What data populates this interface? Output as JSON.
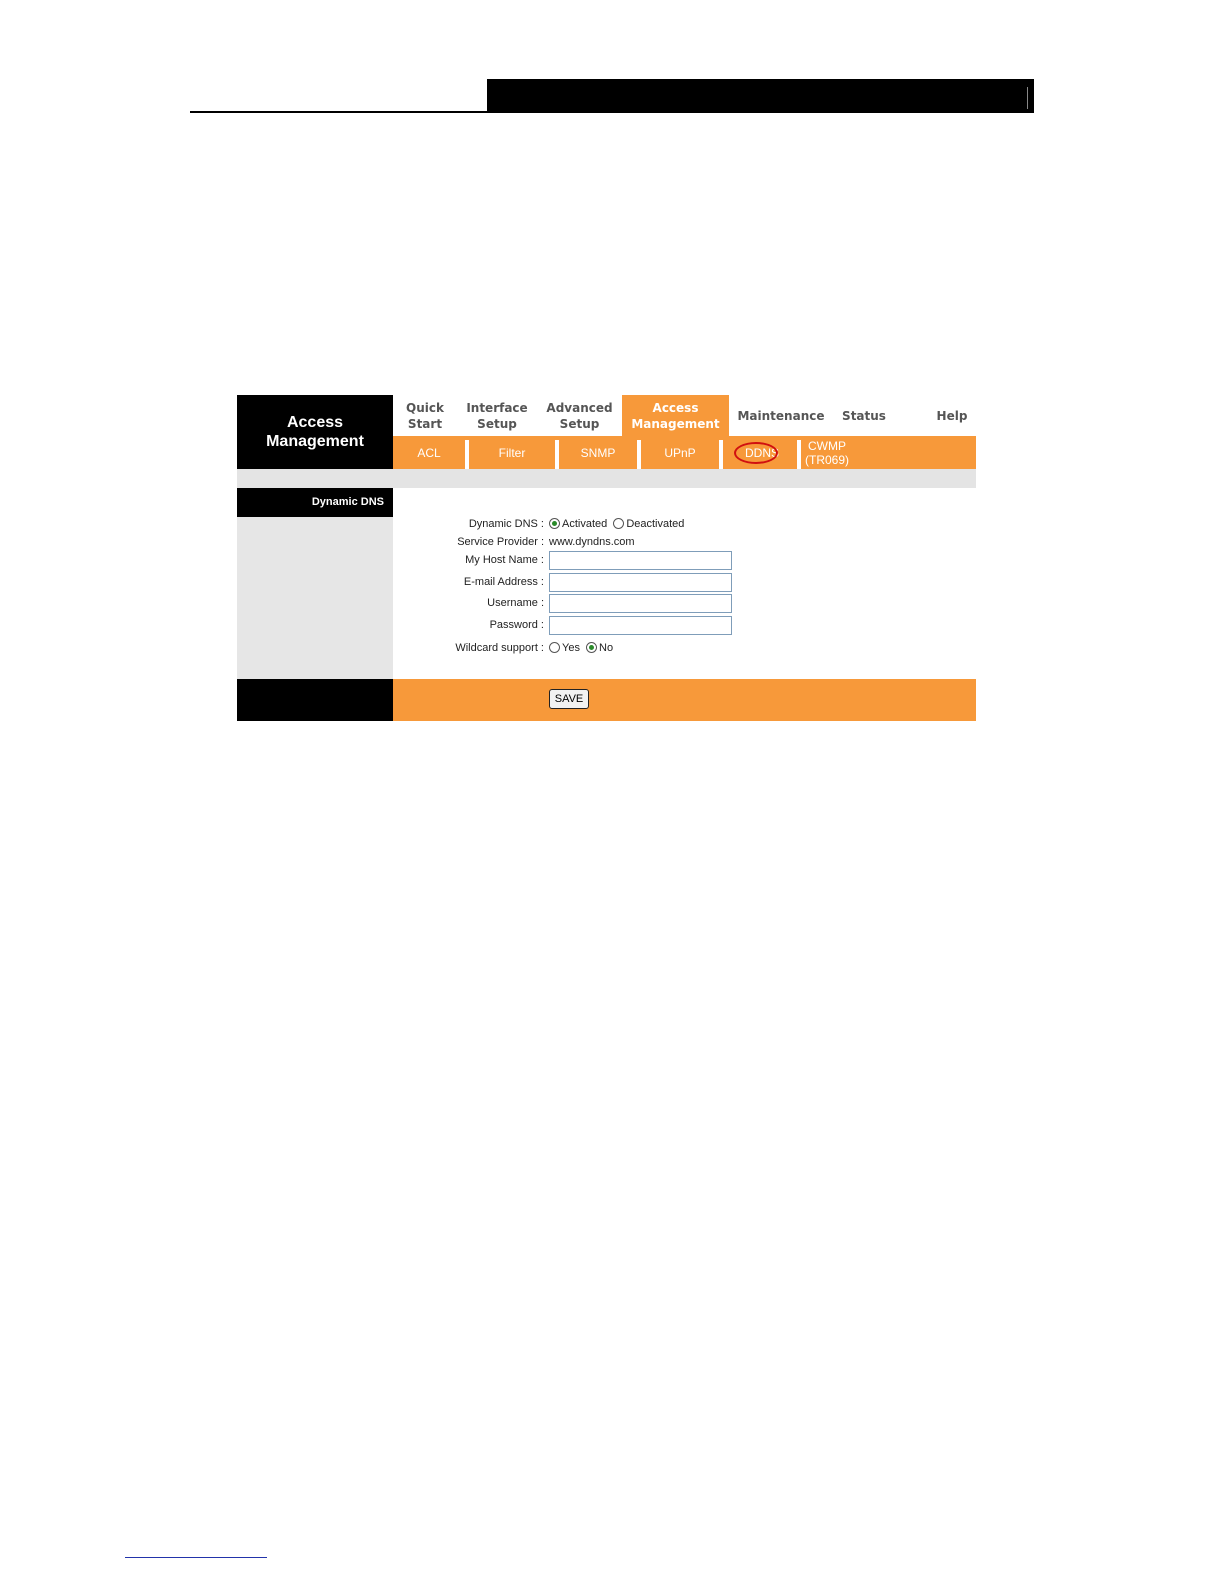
{
  "page": {
    "logo_line1": "Access",
    "logo_line2": "Management"
  },
  "topnav": [
    {
      "line1": "Quick",
      "line2": "Start"
    },
    {
      "line1": "Interface",
      "line2": "Setup"
    },
    {
      "line1": "Advanced",
      "line2": "Setup"
    },
    {
      "line1": "Access",
      "line2": "Management",
      "active": true
    },
    {
      "line1": "Maintenance",
      "line2": ""
    },
    {
      "line1": "Status",
      "line2": ""
    },
    {
      "line1": "Help",
      "line2": ""
    }
  ],
  "subnav": [
    {
      "label": "ACL"
    },
    {
      "label": "Filter"
    },
    {
      "label": "SNMP"
    },
    {
      "label": "UPnP"
    },
    {
      "label": "DDNS",
      "highlighted": true
    },
    {
      "line1": "CWMP",
      "line2": "(TR069)"
    }
  ],
  "sidebar": {
    "title": "Dynamic DNS"
  },
  "form": {
    "dynamic_dns_label": "Dynamic DNS :",
    "activated_label": "Activated",
    "deactivated_label": "Deactivated",
    "dynamic_dns_value": "Activated",
    "service_provider_label": "Service Provider :",
    "service_provider_value": "www.dyndns.com",
    "host_name_label": "My Host Name :",
    "host_name_value": "",
    "email_label": "E-mail Address :",
    "email_value": "",
    "username_label": "Username :",
    "username_value": "",
    "password_label": "Password :",
    "password_value": "",
    "wildcard_label": "Wildcard support :",
    "wildcard_yes_label": "Yes",
    "wildcard_no_label": "No",
    "wildcard_value": "No"
  },
  "footer": {
    "save_label": "SAVE"
  },
  "colors": {
    "accent": "#f7993a",
    "sidebar": "#000000",
    "highlight_circle": "#d01010"
  }
}
